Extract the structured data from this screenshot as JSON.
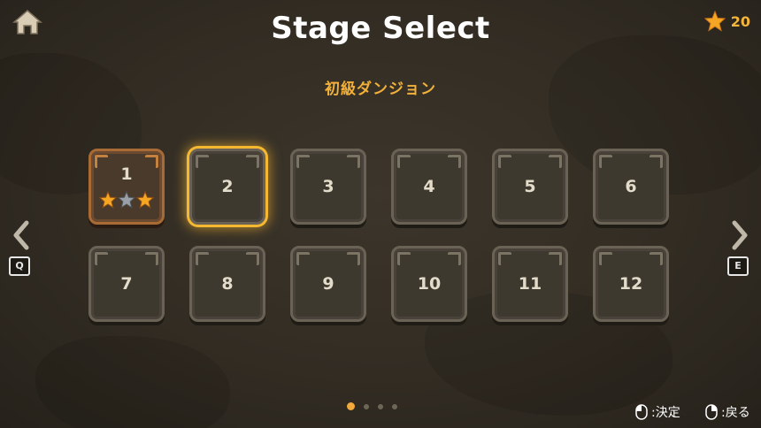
{
  "header": {
    "title": "Stage Select",
    "star_count": "20",
    "subtitle": "初級ダンジョン"
  },
  "stages": [
    {
      "label": "1",
      "state": "cleared",
      "stars": [
        1,
        0,
        1
      ]
    },
    {
      "label": "2",
      "state": "selected"
    },
    {
      "label": "3",
      "state": "locked"
    },
    {
      "label": "4",
      "state": "locked"
    },
    {
      "label": "5",
      "state": "locked"
    },
    {
      "label": "6",
      "state": "locked"
    },
    {
      "label": "7",
      "state": "locked"
    },
    {
      "label": "8",
      "state": "locked"
    },
    {
      "label": "9",
      "state": "locked"
    },
    {
      "label": "10",
      "state": "locked"
    },
    {
      "label": "11",
      "state": "locked"
    },
    {
      "label": "12",
      "state": "locked"
    }
  ],
  "nav": {
    "prev_key": "Q",
    "next_key": "E"
  },
  "pagination": {
    "current": 1,
    "total": 4
  },
  "hints": {
    "confirm": ":決定",
    "back": ":戻る"
  },
  "colors": {
    "accent": "#f2b13a",
    "selected_glow": "#f6b731",
    "star_gold": "#f5a623",
    "star_silver": "#9aa0a8"
  },
  "icons": {
    "home": "home-icon",
    "star": "star-icon",
    "prev": "chevron-left-icon",
    "next": "chevron-right-icon",
    "mouse_left": "mouse-left-click-icon",
    "mouse_right": "mouse-right-click-icon"
  }
}
